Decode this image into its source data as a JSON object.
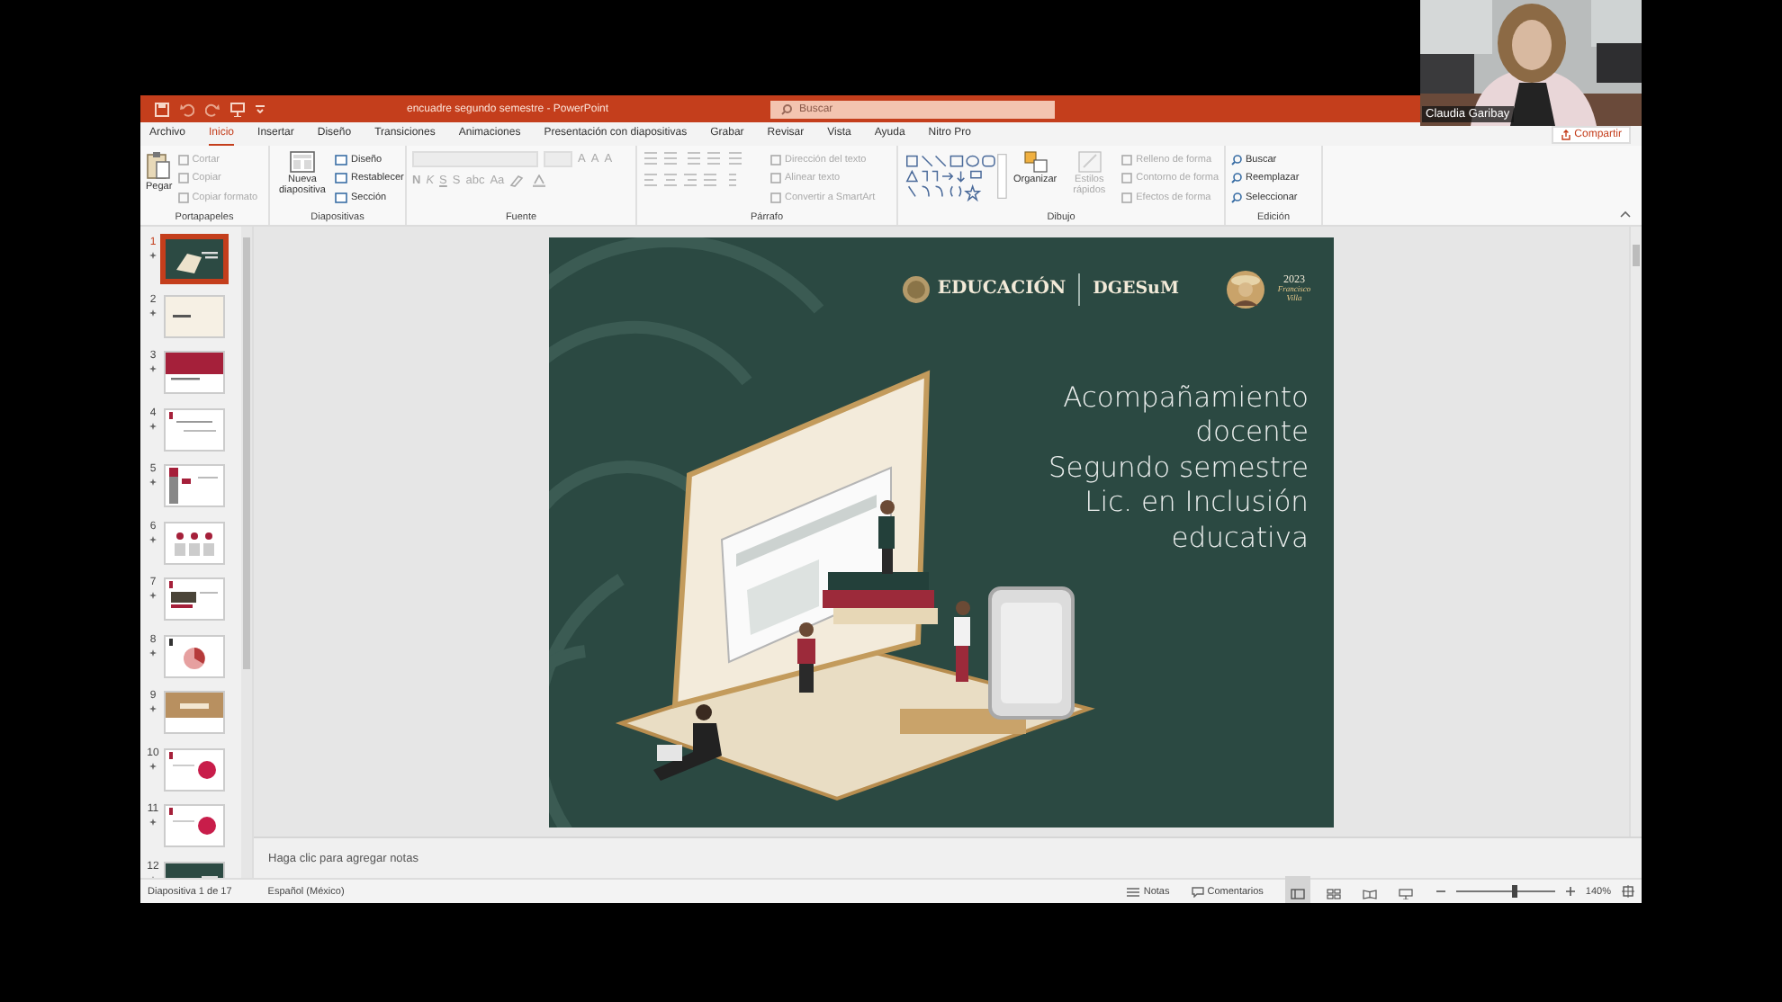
{
  "call": {
    "participant_name": "Claudia Garibay"
  },
  "window": {
    "title": "encuadre segundo semestre  -  PowerPoint",
    "search_placeholder": "Buscar"
  },
  "tabs": [
    {
      "label": "Archivo",
      "selected": false
    },
    {
      "label": "Inicio",
      "selected": true
    },
    {
      "label": "Insertar",
      "selected": false
    },
    {
      "label": "Diseño",
      "selected": false
    },
    {
      "label": "Transiciones",
      "selected": false
    },
    {
      "label": "Animaciones",
      "selected": false
    },
    {
      "label": "Presentación con diapositivas",
      "selected": false
    },
    {
      "label": "Grabar",
      "selected": false
    },
    {
      "label": "Revisar",
      "selected": false
    },
    {
      "label": "Vista",
      "selected": false
    },
    {
      "label": "Ayuda",
      "selected": false
    },
    {
      "label": "Nitro Pro",
      "selected": false
    }
  ],
  "share_button": "Compartir",
  "clipboard": {
    "label": "Portapapeles",
    "paste": {
      "label": "Pegar",
      "disabled": false
    },
    "commands": [
      {
        "label": "Cortar",
        "disabled": true
      },
      {
        "label": "Copiar",
        "disabled": true
      },
      {
        "label": "Copiar formato",
        "disabled": true
      }
    ]
  },
  "slides_group": {
    "label": "Diapositivas",
    "new_slide": {
      "label": "Nueva diapositiva",
      "disabled": false
    },
    "commands": [
      {
        "label": "Diseño",
        "disabled": false
      },
      {
        "label": "Restablecer",
        "disabled": false
      },
      {
        "label": "Sección",
        "disabled": false
      }
    ]
  },
  "font_group": {
    "label": "Fuente",
    "disabled": true,
    "size_buttons": [
      "A",
      "A",
      "A"
    ],
    "format_buttons": [
      "N",
      "K",
      "S",
      "S",
      "abc",
      "Aa"
    ]
  },
  "paragraph_group": {
    "label": "Párrafo",
    "commands": [
      {
        "label": "Dirección del texto",
        "disabled": true
      },
      {
        "label": "Alinear texto",
        "disabled": true
      },
      {
        "label": "Convertir a SmartArt",
        "disabled": true
      }
    ]
  },
  "drawing_group": {
    "label": "Dibujo",
    "arrange": {
      "label": "Organizar",
      "disabled": false
    },
    "quick_styles": {
      "label": "Estilos rápidos",
      "disabled": true
    },
    "commands": [
      {
        "label": "Relleno de forma",
        "disabled": true
      },
      {
        "label": "Contorno de forma",
        "disabled": true
      },
      {
        "label": "Efectos de forma",
        "disabled": true
      }
    ]
  },
  "editing_group": {
    "label": "Edición",
    "commands": [
      {
        "label": "Buscar",
        "disabled": false
      },
      {
        "label": "Reemplazar",
        "disabled": false
      },
      {
        "label": "Seleccionar",
        "disabled": false
      }
    ]
  },
  "thumbnails": [
    {
      "number": "1",
      "kind": "cover",
      "selected": true
    },
    {
      "number": "2",
      "kind": "title",
      "selected": false
    },
    {
      "number": "3",
      "kind": "banner",
      "selected": false
    },
    {
      "number": "4",
      "kind": "text",
      "selected": false
    },
    {
      "number": "5",
      "kind": "sidebar",
      "selected": false
    },
    {
      "number": "6",
      "kind": "columns",
      "selected": false
    },
    {
      "number": "7",
      "selected": false
    },
    {
      "number": "8",
      "kind": "chart",
      "selected": false
    },
    {
      "number": "9",
      "kind": "tan",
      "selected": false
    },
    {
      "number": "10",
      "kind": "badge",
      "selected": false
    },
    {
      "number": "11",
      "kind": "badge",
      "selected": false
    },
    {
      "number": "12",
      "kind": "cover",
      "selected": false
    }
  ],
  "slide": {
    "logo_main": "EDUCACIÓN",
    "logo_agency": "DGESuM",
    "badge_year": "2023",
    "badge_name": "Francisco Villa",
    "title_lines": [
      "Acompañamiento",
      "docente",
      "Segundo semestre",
      "Lic. en Inclusión",
      "educativa"
    ]
  },
  "notes": {
    "placeholder": "Haga clic para agregar notas"
  },
  "status_bar": {
    "slide_position": "Diapositiva 1 de 17",
    "language": "Español (México)",
    "notes_button": "Notas",
    "comments_button": "Comentarios",
    "views": [
      {
        "kind": "normal",
        "selected": true
      },
      {
        "kind": "sorter",
        "selected": false
      },
      {
        "kind": "reading",
        "selected": false
      },
      {
        "kind": "slideshow",
        "selected": false
      }
    ],
    "zoom": {
      "level": 0.6,
      "reading": "140%"
    }
  }
}
